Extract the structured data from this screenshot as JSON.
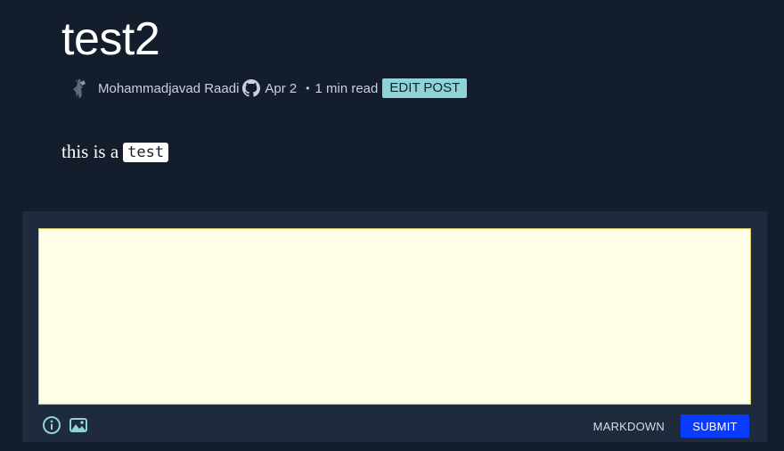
{
  "post": {
    "title": "test2",
    "author": "Mohammadjavad Raadi",
    "date": "Apr 2",
    "separator": "•",
    "read_time": "1 min read",
    "edit_label": "EDIT POST",
    "body_text": "this is a",
    "body_code": "test"
  },
  "comment": {
    "placeholder": "",
    "markdown_label": "MARKDOWN",
    "submit_label": "SUBMIT"
  },
  "icons": {
    "avatar": "avatar-image",
    "github": "github-icon",
    "info": "info-icon",
    "image": "image-icon"
  },
  "colors": {
    "background": "#141d2b",
    "comment_panel": "#1f2a3d",
    "textarea_bg": "#ffffe8",
    "edit_button": "#8ed3d8",
    "submit_button": "#0a3cff",
    "icon_teal": "#8ed3d8"
  }
}
